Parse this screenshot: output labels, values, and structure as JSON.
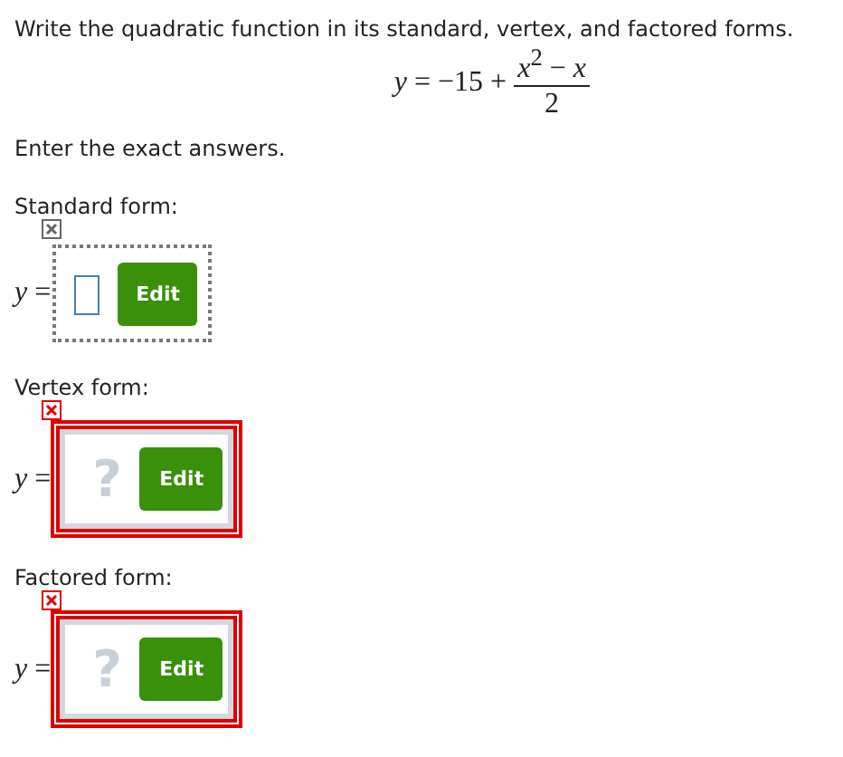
{
  "prompt": "Write the quadratic function in its standard, vertex, and factored forms.",
  "equation": {
    "lhs": "*y* = −15 +",
    "numerator": "*x*$^{2}$ − *x*",
    "denominator": "2"
  },
  "instruction": "Enter the exact answers.",
  "answers": [
    {
      "label": "Standard form:",
      "prefix": "y =",
      "kind": "empty",
      "button": "Edit"
    },
    {
      "label": "Vertex form:",
      "prefix": "y =",
      "kind": "invalid",
      "mark": "?",
      "button": "Edit"
    },
    {
      "label": "Factored form:",
      "prefix": "y =",
      "kind": "invalid",
      "mark": "?",
      "button": "Edit"
    }
  ]
}
